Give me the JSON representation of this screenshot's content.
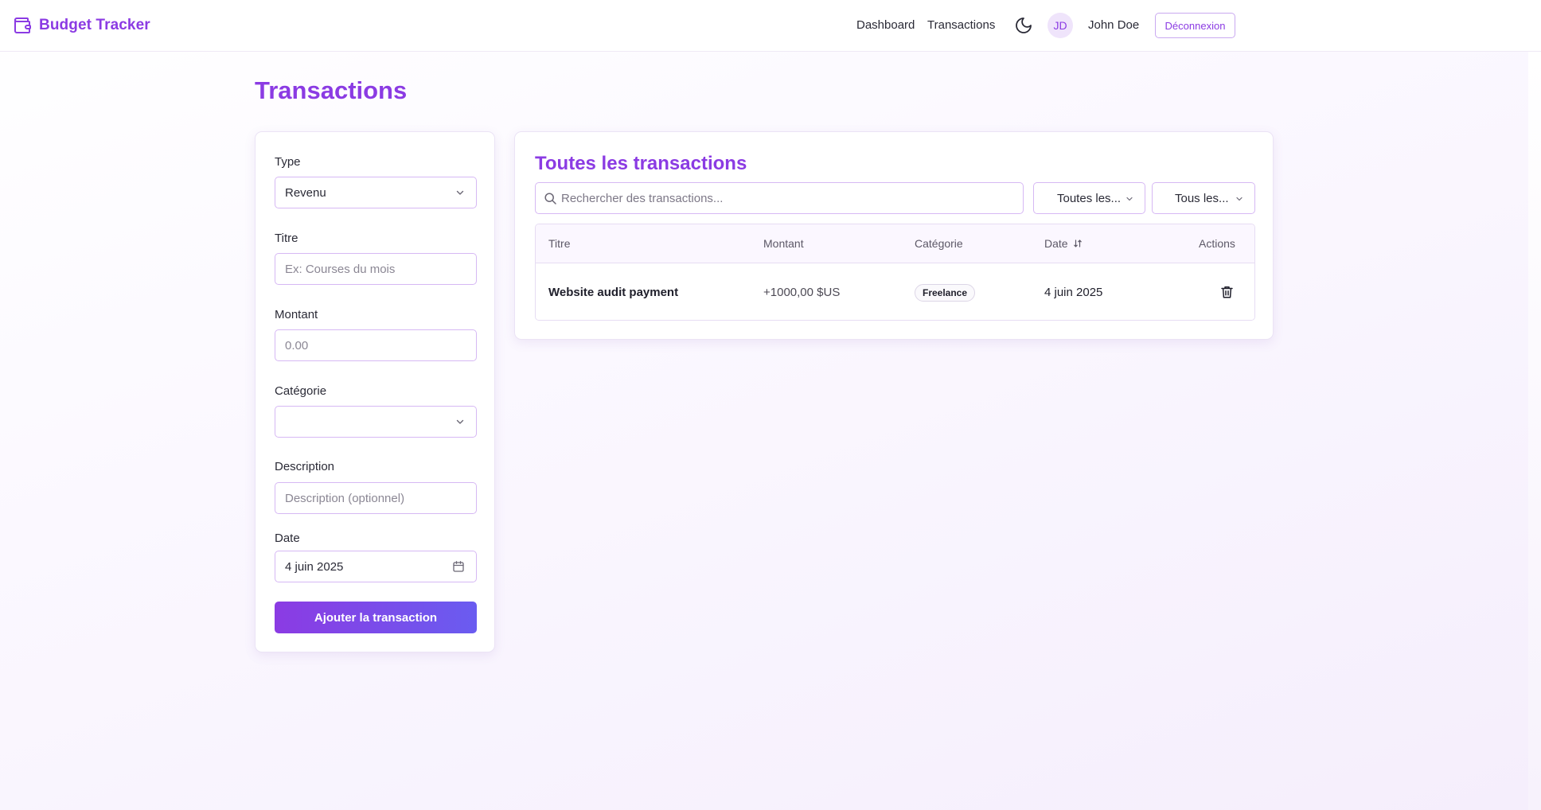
{
  "header": {
    "brand": "Budget Tracker",
    "brand_color": "#8b3be3",
    "nav": {
      "dashboard": "Dashboard",
      "transactions": "Transactions"
    },
    "theme_icon": "moon-icon",
    "avatar_initials": "JD",
    "user_name": "John Doe",
    "logout_label": "Déconnexion"
  },
  "page": {
    "title": "Transactions"
  },
  "form": {
    "type_label": "Type",
    "type_value": "Revenu",
    "title_label": "Titre",
    "title_placeholder": "Ex: Courses du mois",
    "amount_label": "Montant",
    "amount_placeholder": "0.00",
    "category_label": "Catégorie",
    "category_value": "",
    "description_label": "Description",
    "description_placeholder": "Description (optionnel)",
    "date_label": "Date",
    "date_value": "4 juin 2025",
    "submit_label": "Ajouter la transaction"
  },
  "list": {
    "title": "Toutes les transactions",
    "search_placeholder": "Rechercher des transactions...",
    "filter_category": "Toutes les...",
    "filter_type": "Tous les...",
    "columns": {
      "title": "Titre",
      "amount": "Montant",
      "category": "Catégorie",
      "date": "Date",
      "actions": "Actions"
    },
    "rows": [
      {
        "title": "Website audit payment",
        "amount": "+1000,00 $US",
        "category": "Freelance",
        "date": "4 juin 2025"
      }
    ]
  }
}
